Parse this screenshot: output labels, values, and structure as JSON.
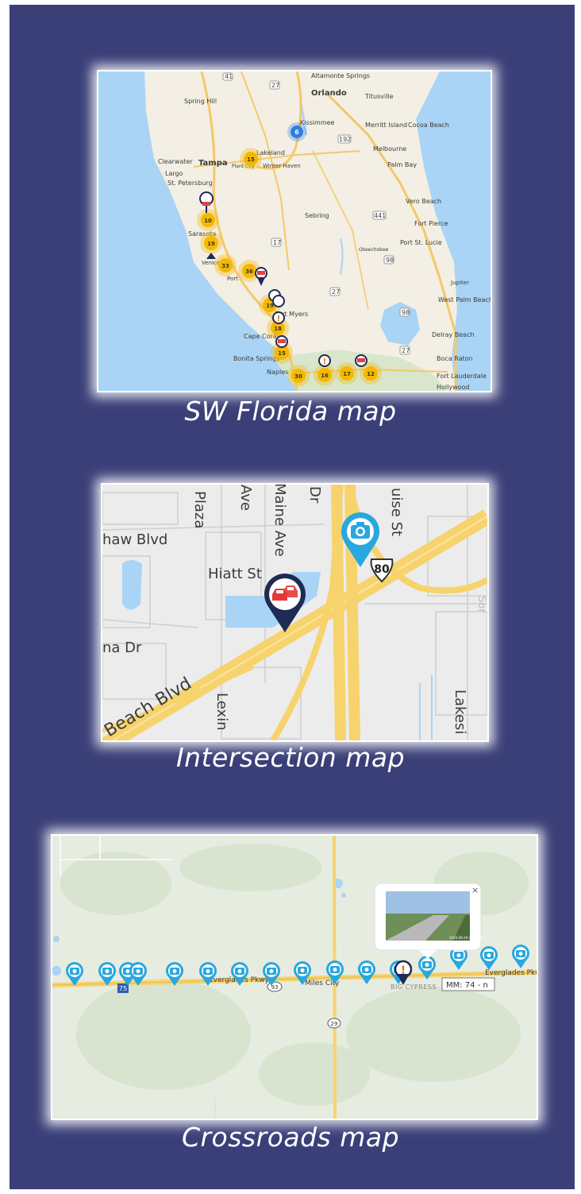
{
  "maps": [
    {
      "caption": "SW Florida map",
      "cities": [
        "Altamonte Springs",
        "Orlando",
        "Titusville",
        "Spring Hill",
        "Kissimmee",
        "Merritt Island",
        "Cocoa Beach",
        "Lakeland",
        "Clearwater",
        "Tampa",
        "Plant City",
        "Winter Haven",
        "Melbourne",
        "Largo",
        "St. Petersburg",
        "Palm Bay",
        "Vero Beach",
        "Sebring",
        "Fort Pierce",
        "Sarasota",
        "Port St. Lucie",
        "Okeechobee",
        "Venice",
        "Port",
        "Jupiter",
        "West Palm Beach",
        "Fort Myers",
        "Cape Coral",
        "Delray Beach",
        "Boca Raton",
        "Bonita Springs",
        "Fort Lauderdale",
        "Naples",
        "Hollywood"
      ],
      "highway_shields": [
        "41",
        "27",
        "192",
        "441",
        "17",
        "98",
        "27",
        "98",
        "27"
      ],
      "clusters": [
        "6",
        "15",
        "10",
        "19",
        "33",
        "36",
        "19",
        "18",
        "15",
        "30",
        "16",
        "17",
        "12"
      ],
      "cluster_color": "#f5b800",
      "blue_cluster_color": "#2f7de1",
      "marker_icons": [
        "crash-icon",
        "alert-icon"
      ]
    },
    {
      "caption": "Intersection map",
      "street_labels": [
        "Plaza",
        "Ave",
        "Maine Ave",
        "Dr",
        "uise St",
        "haw Blvd",
        "Hiatt St",
        "na Dr",
        "Beach Blvd",
        "Lexin",
        "Lakesi",
        "Sor"
      ],
      "route_shield": "80",
      "marker_icons": [
        "camera-icon",
        "crash-icon"
      ],
      "camera_marker_color": "#29a7df",
      "crash_marker_color": "#1f2a55",
      "road_color": "#f7d36e"
    },
    {
      "caption": "Crossroads map",
      "road_labels": [
        "Everglades Pkwy",
        "Everglades Pkwy",
        "Miles City",
        "BIG CYPRESS"
      ],
      "shields": [
        "75",
        "93",
        "29"
      ],
      "camera_count": 16,
      "tooltip": "MM: 74 - n",
      "popup_close": "×",
      "popup_caption": "2020-08-26 09:00:00",
      "marker_color": "#29a7df"
    }
  ],
  "colors": {
    "panel": "#3a3f78",
    "glow": "#ffffff"
  }
}
